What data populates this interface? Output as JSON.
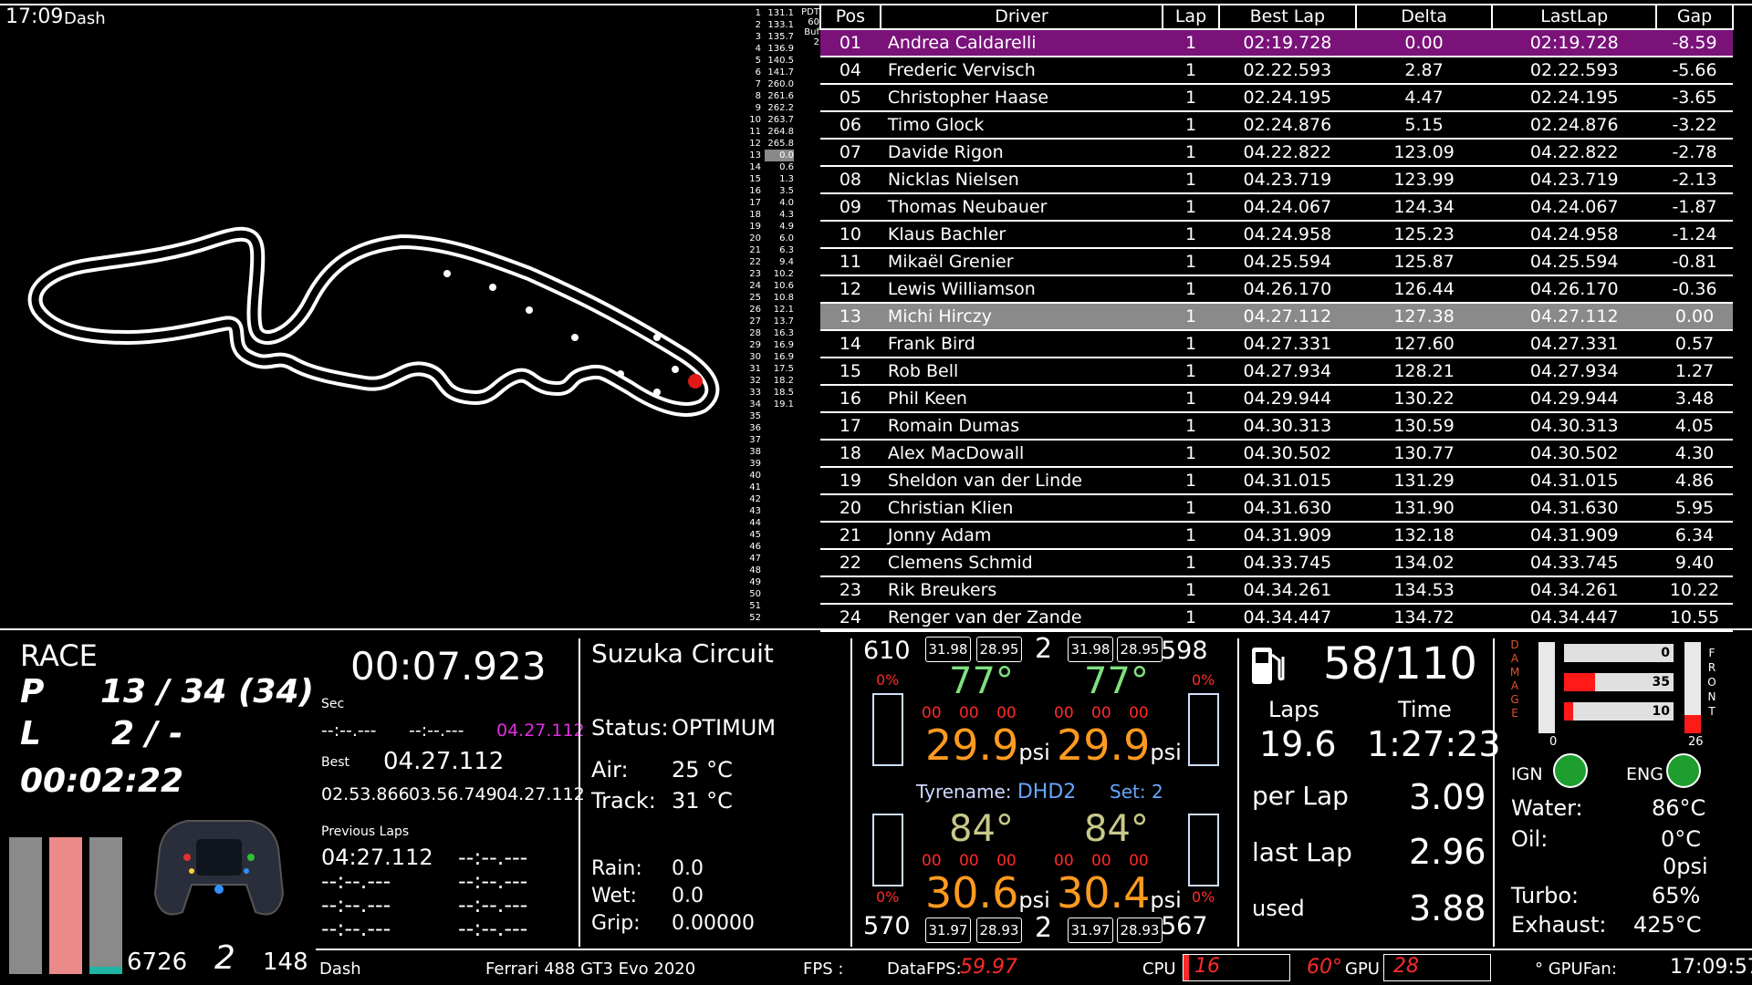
{
  "clock": "17:09",
  "app_name": "Dash",
  "pdt": {
    "label1": "PDT",
    "value1": "60",
    "label2": "Buf",
    "value2": "2"
  },
  "minilist": [
    {
      "n": "1",
      "v": "131.1"
    },
    {
      "n": "2",
      "v": "133.1"
    },
    {
      "n": "3",
      "v": "135.7"
    },
    {
      "n": "4",
      "v": "136.9"
    },
    {
      "n": "5",
      "v": "140.5"
    },
    {
      "n": "6",
      "v": "141.7"
    },
    {
      "n": "7",
      "v": "260.0"
    },
    {
      "n": "8",
      "v": "261.6"
    },
    {
      "n": "9",
      "v": "262.2"
    },
    {
      "n": "10",
      "v": "263.7"
    },
    {
      "n": "11",
      "v": "264.8"
    },
    {
      "n": "12",
      "v": "265.8"
    },
    {
      "n": "13",
      "v": "0.0"
    },
    {
      "n": "14",
      "v": "0.6"
    },
    {
      "n": "15",
      "v": "1.3"
    },
    {
      "n": "16",
      "v": "3.5"
    },
    {
      "n": "17",
      "v": "4.0"
    },
    {
      "n": "18",
      "v": "4.3"
    },
    {
      "n": "19",
      "v": "4.9"
    },
    {
      "n": "20",
      "v": "6.0"
    },
    {
      "n": "21",
      "v": "6.3"
    },
    {
      "n": "22",
      "v": "9.4"
    },
    {
      "n": "23",
      "v": "10.2"
    },
    {
      "n": "24",
      "v": "10.6"
    },
    {
      "n": "25",
      "v": "10.8"
    },
    {
      "n": "26",
      "v": "12.1"
    },
    {
      "n": "27",
      "v": "13.7"
    },
    {
      "n": "28",
      "v": "16.3"
    },
    {
      "n": "29",
      "v": "16.9"
    },
    {
      "n": "30",
      "v": "16.9"
    },
    {
      "n": "31",
      "v": "17.5"
    },
    {
      "n": "32",
      "v": "18.2"
    },
    {
      "n": "33",
      "v": "18.5"
    },
    {
      "n": "34",
      "v": "19.1"
    },
    {
      "n": "35",
      "v": ""
    },
    {
      "n": "36",
      "v": ""
    },
    {
      "n": "37",
      "v": ""
    },
    {
      "n": "38",
      "v": ""
    },
    {
      "n": "39",
      "v": ""
    },
    {
      "n": "40",
      "v": ""
    },
    {
      "n": "41",
      "v": ""
    },
    {
      "n": "42",
      "v": ""
    },
    {
      "n": "43",
      "v": ""
    },
    {
      "n": "44",
      "v": ""
    },
    {
      "n": "45",
      "v": ""
    },
    {
      "n": "46",
      "v": ""
    },
    {
      "n": "47",
      "v": ""
    },
    {
      "n": "48",
      "v": ""
    },
    {
      "n": "49",
      "v": ""
    },
    {
      "n": "50",
      "v": ""
    },
    {
      "n": "51",
      "v": ""
    },
    {
      "n": "52",
      "v": ""
    }
  ],
  "table": {
    "headers": [
      "Pos",
      "Driver",
      "Lap",
      "Best Lap",
      "Delta",
      "LastLap",
      "Gap"
    ],
    "rows": [
      {
        "pos": "01",
        "driver": "Andrea Caldarelli",
        "lap": "1",
        "best": "02:19.728",
        "delta": "0.00",
        "last": "02:19.728",
        "gap": "-8.59",
        "style": "leader"
      },
      {
        "pos": "04",
        "driver": "Frederic Vervisch",
        "lap": "1",
        "best": "02.22.593",
        "delta": "2.87",
        "last": "02.22.593",
        "gap": "-5.66"
      },
      {
        "pos": "05",
        "driver": "Christopher Haase",
        "lap": "1",
        "best": "02.24.195",
        "delta": "4.47",
        "last": "02.24.195",
        "gap": "-3.65"
      },
      {
        "pos": "06",
        "driver": "Timo Glock",
        "lap": "1",
        "best": "02.24.876",
        "delta": "5.15",
        "last": "02.24.876",
        "gap": "-3.22"
      },
      {
        "pos": "07",
        "driver": "Davide Rigon",
        "lap": "1",
        "best": "04.22.822",
        "delta": "123.09",
        "last": "04.22.822",
        "gap": "-2.78"
      },
      {
        "pos": "08",
        "driver": "Nicklas Nielsen",
        "lap": "1",
        "best": "04.23.719",
        "delta": "123.99",
        "last": "04.23.719",
        "gap": "-2.13"
      },
      {
        "pos": "09",
        "driver": "Thomas Neubauer",
        "lap": "1",
        "best": "04.24.067",
        "delta": "124.34",
        "last": "04.24.067",
        "gap": "-1.87"
      },
      {
        "pos": "10",
        "driver": "Klaus Bachler",
        "lap": "1",
        "best": "04.24.958",
        "delta": "125.23",
        "last": "04.24.958",
        "gap": "-1.24"
      },
      {
        "pos": "11",
        "driver": "Mikaël Grenier",
        "lap": "1",
        "best": "04.25.594",
        "delta": "125.87",
        "last": "04.25.594",
        "gap": "-0.81"
      },
      {
        "pos": "12",
        "driver": "Lewis Williamson",
        "lap": "1",
        "best": "04.26.170",
        "delta": "126.44",
        "last": "04.26.170",
        "gap": "-0.36"
      },
      {
        "pos": "13",
        "driver": "Michi Hirczy",
        "lap": "1",
        "best": "04.27.112",
        "delta": "127.38",
        "last": "04.27.112",
        "gap": "0.00",
        "style": "self"
      },
      {
        "pos": "14",
        "driver": "Frank Bird",
        "lap": "1",
        "best": "04.27.331",
        "delta": "127.60",
        "last": "04.27.331",
        "gap": "0.57"
      },
      {
        "pos": "15",
        "driver": "Rob Bell",
        "lap": "1",
        "best": "04.27.934",
        "delta": "128.21",
        "last": "04.27.934",
        "gap": "1.27"
      },
      {
        "pos": "16",
        "driver": "Phil Keen",
        "lap": "1",
        "best": "04.29.944",
        "delta": "130.22",
        "last": "04.29.944",
        "gap": "3.48"
      },
      {
        "pos": "17",
        "driver": "Romain Dumas",
        "lap": "1",
        "best": "04.30.313",
        "delta": "130.59",
        "last": "04.30.313",
        "gap": "4.05"
      },
      {
        "pos": "18",
        "driver": "Alex MacDowall",
        "lap": "1",
        "best": "04.30.502",
        "delta": "130.77",
        "last": "04.30.502",
        "gap": "4.30"
      },
      {
        "pos": "19",
        "driver": "Sheldon van der Linde",
        "lap": "1",
        "best": "04.31.015",
        "delta": "131.29",
        "last": "04.31.015",
        "gap": "4.86"
      },
      {
        "pos": "20",
        "driver": "Christian Klien",
        "lap": "1",
        "best": "04.31.630",
        "delta": "131.90",
        "last": "04.31.630",
        "gap": "5.95"
      },
      {
        "pos": "21",
        "driver": "Jonny Adam",
        "lap": "1",
        "best": "04.31.909",
        "delta": "132.18",
        "last": "04.31.909",
        "gap": "6.34"
      },
      {
        "pos": "22",
        "driver": "Clemens Schmid",
        "lap": "1",
        "best": "04.33.745",
        "delta": "134.02",
        "last": "04.33.745",
        "gap": "9.40"
      },
      {
        "pos": "23",
        "driver": "Rik Breukers",
        "lap": "1",
        "best": "04.34.261",
        "delta": "134.53",
        "last": "04.34.261",
        "gap": "10.22"
      },
      {
        "pos": "24",
        "driver": "Renger van der Zande",
        "lap": "1",
        "best": "04.34.447",
        "delta": "134.72",
        "last": "04.34.447",
        "gap": "10.55"
      }
    ]
  },
  "session": {
    "type": "RACE",
    "p_label": "P",
    "position": "13 / 34 (34)",
    "l_label": "L",
    "lap": "2 / -",
    "elapsed": "00:02:22"
  },
  "bars": {
    "colors": [
      "#8a8a8a",
      "#ec8a8a",
      "#8a8a8a"
    ],
    "levels": [
      1.0,
      1.0,
      1.0
    ],
    "accent": "#1fb5a5",
    "accent_level": 0.05
  },
  "rpm": "6726",
  "gear": "2",
  "speed": "148",
  "laptime": {
    "current": "00:07.923",
    "sec_label": "Sec",
    "sectors": [
      "--:--.---",
      "--:--.---",
      "04.27.112"
    ],
    "best_label": "Best",
    "best": "04.27.112",
    "best_sectors": [
      "02.53.866",
      "03.56.749",
      "04.27.112"
    ],
    "prev_label": "Previous Laps",
    "prev": [
      "04:27.112",
      "--:--.---",
      "--:--.---",
      "--:--.---",
      "--:--.---",
      "--:--.---",
      "--:--.---",
      "--:--.---"
    ]
  },
  "track": {
    "name": "Suzuka Circuit",
    "status_label": "Status:",
    "status": "OPTIMUM",
    "air_label": "Air:",
    "air": "25 °C",
    "track_label": "Track:",
    "track_temp": "31 °C",
    "rain_label": "Rain:",
    "rain": "0.0",
    "wet_label": "Wet:",
    "wet": "0.0",
    "grip_label": "Grip:",
    "grip": "0.00000"
  },
  "tyres": {
    "fl_load": "610",
    "fr_load": "598",
    "rl_load": "570",
    "rr_load": "567",
    "front_gear": "2",
    "rear_gear": "2",
    "fl_boxes": [
      "31.98",
      "28.95"
    ],
    "fr_boxes": [
      "31.98",
      "28.95"
    ],
    "rl_boxes": [
      "31.97",
      "28.93"
    ],
    "rr_boxes": [
      "31.97",
      "28.93"
    ],
    "fl_temp": "77°",
    "fr_temp": "77°",
    "rl_temp": "84°",
    "rr_temp": "84°",
    "fl_psi": "29.9",
    "fr_psi": "29.9",
    "rl_psi": "30.6",
    "rr_psi": "30.4",
    "psi_unit": "psi",
    "wear": [
      "00",
      "00",
      "00"
    ],
    "pct": "0%",
    "tyrename_label": "Tyrename:",
    "tyrename": "DHD2",
    "set_label": "Set:",
    "set": "2"
  },
  "fuel": {
    "amount": "58/110",
    "laps_label": "Laps",
    "laps": "19.6",
    "time_label": "Time",
    "time": "1:27:23",
    "perlap_label": "per Lap",
    "perlap": "3.09",
    "lastlap_label": "last Lap",
    "lastlap": "2.96",
    "used_label": "used",
    "used": "3.88"
  },
  "damage": {
    "left_letters": "DAMAGE",
    "right_letters": "FRONT",
    "bars": [
      {
        "value": "0",
        "fraction": 0.0
      },
      {
        "value": "35",
        "fraction": 0.28
      },
      {
        "value": "10",
        "fraction": 0.08
      }
    ],
    "min": "0",
    "max": "26",
    "ign_label": "IGN",
    "eng_label": "ENG",
    "water_label": "Water:",
    "water": "86°C",
    "oil_label": "Oil:",
    "oil": "0°C",
    "oil_psi": "0psi",
    "turbo_label": "Turbo:",
    "turbo": "65%",
    "exhaust_label": "Exhaust:",
    "exhaust": "425°C"
  },
  "footer": {
    "app": "Dash",
    "car": "Ferrari 488 GT3 Evo 2020",
    "fps_label": "FPS :",
    "datafps_label": "DataFPS:",
    "datafps": "59.97",
    "cpu_label": "CPU",
    "cpu": "16",
    "cpu_temp": "60°",
    "gpu_label": "GPU",
    "gpu": "28",
    "gpufan_label": "° GPUFan:",
    "time": "17:09:57"
  }
}
